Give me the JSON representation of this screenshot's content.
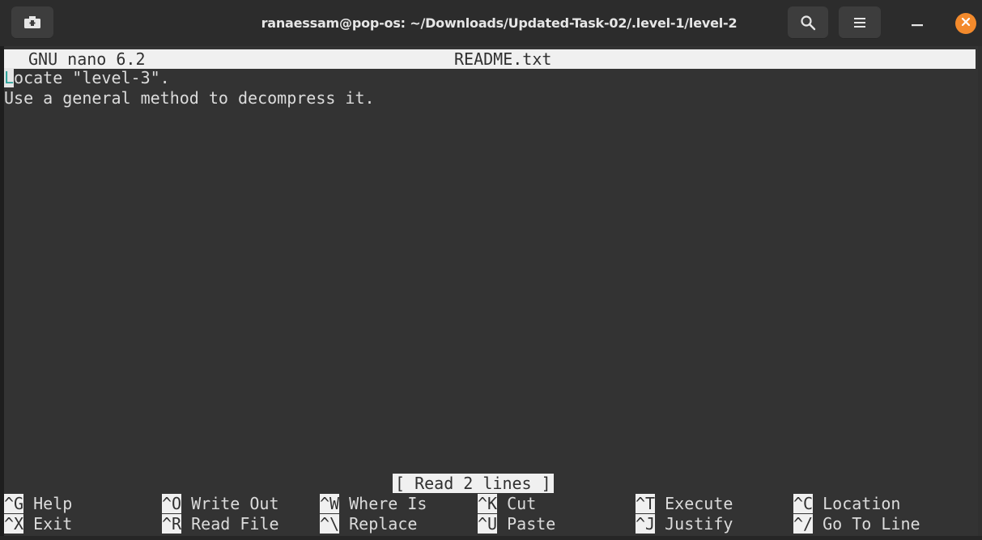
{
  "window": {
    "title": "ranaessam@pop-os: ~/Downloads/Updated-Task-02/.level-1/level-2",
    "close_color": "#f38a2c"
  },
  "nano": {
    "app": "GNU nano 6.2",
    "filename": "README.txt",
    "lines": [
      "Locate \"level-3\".",
      "Use a general method to decompress it."
    ],
    "status": "[ Read 2 lines ]",
    "shortcuts": [
      {
        "key": "^G",
        "label": "Help"
      },
      {
        "key": "^O",
        "label": "Write Out"
      },
      {
        "key": "^W",
        "label": "Where Is"
      },
      {
        "key": "^K",
        "label": "Cut"
      },
      {
        "key": "^T",
        "label": "Execute"
      },
      {
        "key": "^C",
        "label": "Location"
      },
      {
        "key": "^X",
        "label": "Exit"
      },
      {
        "key": "^R",
        "label": "Read File"
      },
      {
        "key": "^\\",
        "label": "Replace"
      },
      {
        "key": "^U",
        "label": "Paste"
      },
      {
        "key": "^J",
        "label": "Justify"
      },
      {
        "key": "^/",
        "label": "Go To Line"
      }
    ]
  }
}
